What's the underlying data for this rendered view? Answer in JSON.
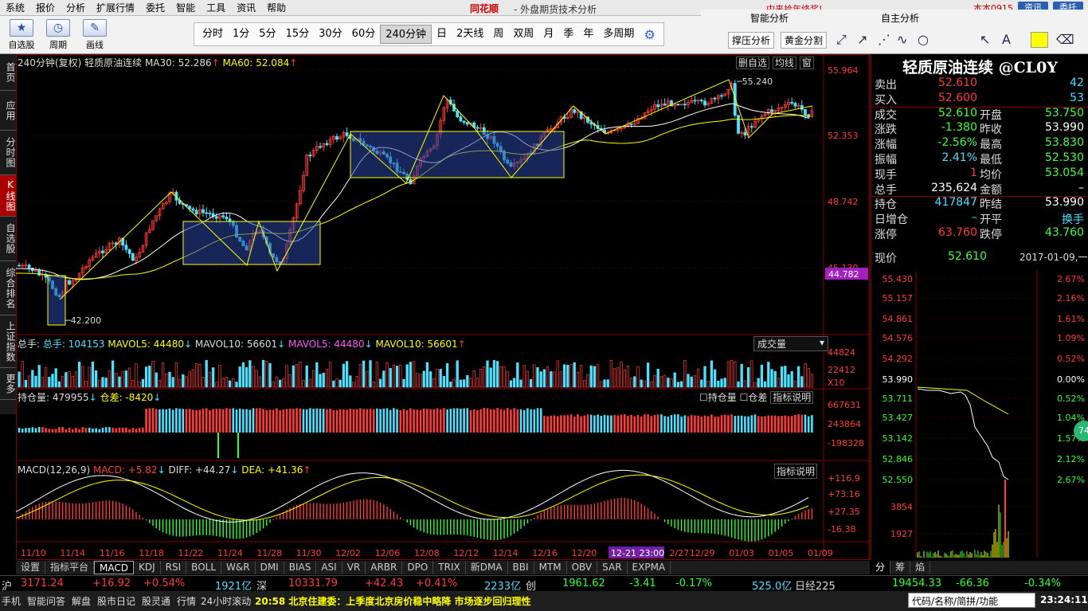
{
  "menu": {
    "items": [
      "系统",
      "报价",
      "分析",
      "扩展行情",
      "委托",
      "智能",
      "工具",
      "资讯",
      "帮助"
    ],
    "brand": "同花顺",
    "title": "- 外盘期货技术分析",
    "marquee": "中来拾年终奖!",
    "user": "本本0915",
    "btn_info": "资讯",
    "btn_trade": "委托"
  },
  "toolbar": {
    "zixuan": "自选股",
    "zhouqi": "周期",
    "huaxian": "画线",
    "periods": [
      "分时",
      "1分",
      "5分",
      "15分",
      "30分",
      "60分",
      "240分钟",
      "日",
      "2天线",
      "周",
      "双周",
      "月",
      "季",
      "年",
      "多周期"
    ],
    "selected_period": "240分钟"
  },
  "rtools": {
    "smart": "智能分析",
    "self": "自主分析",
    "btn_support": "撑压分析",
    "btn_golden": "黄金分割"
  },
  "lefttabs": [
    "首页",
    "应用",
    "分时图",
    "K线图",
    "自选股",
    "综合排名",
    "上证指数",
    "更多"
  ],
  "chart": {
    "header": {
      "period": "240分钟(复权)",
      "name": "轻质原油连续",
      "ma30": "MA30: 52.286",
      "ma60": "MA60: 52.084",
      "btn_add": "删自选",
      "btn_ma": "均线",
      "btn_win": "窗"
    },
    "price_axis": [
      "55.964",
      "52.353",
      "48.742",
      "45.130"
    ],
    "current_tag": "44.782",
    "high_label": "55.240",
    "low_label": "42.200",
    "vol_header": {
      "total": "总手: 104153",
      "mavol5": "MAVOL5: 44480",
      "mavol10": "MAVOL10: 56601",
      "mavol5b": "MAVOL5: 44480",
      "mavol10b": "MAVOL10: 56601",
      "dropdown": "成交量"
    },
    "vol_axis": [
      "44824",
      "22412",
      "X10"
    ],
    "oi_header": {
      "oi": "持仓量: 479955",
      "diff": "仓差: -8420",
      "chk_oi": "持仓量",
      "chk_diff": "仓差",
      "btn": "指标说明"
    },
    "oi_axis": [
      "667631",
      "243864",
      "-198328"
    ],
    "macd_header": {
      "name": "MACD(12,26,9)",
      "macd": "MACD: +5.82",
      "diff": "DIFF: +44.27",
      "dea": "DEA: +41.36",
      "btn": "指标说明"
    },
    "macd_axis": [
      "+116.9",
      "+73.16",
      "+27.35",
      "-16.38"
    ],
    "dates": [
      "11/10",
      "11/14",
      "11/16",
      "11/18",
      "11/22",
      "11/24",
      "11/28",
      "11/30",
      "12/02",
      "12/06",
      "12/08",
      "12/12",
      "12/14",
      "12/16",
      "12/20",
      "12-21 23:00",
      "2/27",
      "12/29",
      "01/03",
      "01/05",
      "01/09"
    ]
  },
  "quote": {
    "name": "轻质原油连续 @CL0Y",
    "rows": [
      {
        "l": "卖出",
        "v": "52.610",
        "l2": "",
        "v2": "42"
      },
      {
        "l": "买入",
        "v": "52.600",
        "l2": "",
        "v2": "53"
      },
      {
        "l": "成交",
        "v": "52.610",
        "l2": "开盘",
        "v2": "53.750"
      },
      {
        "l": "涨跌",
        "v": "-1.380",
        "l2": "昨收",
        "v2": "53.990"
      },
      {
        "l": "涨幅",
        "v": "-2.56%",
        "l2": "最高",
        "v2": "53.830"
      },
      {
        "l": "振幅",
        "v": "2.41%",
        "l2": "最低",
        "v2": "52.530"
      },
      {
        "l": "现手",
        "v": "1",
        "l2": "均价",
        "v2": "53.054"
      },
      {
        "l": "总手",
        "v": "235,624",
        "l2": "金额",
        "v2": "–"
      },
      {
        "l": "持仓",
        "v": "417847",
        "l2": "昨结",
        "v2": "53.990"
      },
      {
        "l": "日增仓",
        "v": "–",
        "l2": "开平",
        "v2": "换手"
      },
      {
        "l": "涨停",
        "v": "63.760",
        "l2": "跌停",
        "v2": "43.760"
      }
    ],
    "now_label": "现价",
    "now_value": "52.610",
    "now_date": "2017-01-09,一",
    "mini_left": [
      "55.430",
      "55.157",
      "54.861",
      "54.576",
      "54.292",
      "53.990",
      "53.711",
      "53.427",
      "53.142",
      "52.846",
      "52.550",
      "3854",
      "1927"
    ],
    "mini_right": [
      "2.67%",
      "2.16%",
      "1.61%",
      "1.09%",
      "0.52%",
      "0.00%",
      "0.52%",
      "1.04%",
      "1.57%",
      "2.12%",
      "2.67%"
    ],
    "bubble": "74"
  },
  "indtabs": [
    "设置",
    "指标平台",
    "MACD",
    "KDJ",
    "RSI",
    "BOLL",
    "W&R",
    "DMI",
    "BIAS",
    "ASI",
    "VR",
    "ARBR",
    "DPO",
    "TRIX",
    "新DMA",
    "BBI",
    "MTM",
    "OBV",
    "SAR",
    "EXPMA"
  ],
  "qtabs": [
    "分",
    "筹",
    "焰"
  ],
  "ticker": {
    "sh": "沪",
    "sh_v": "3171.24",
    "sh_c": "+16.92",
    "sh_p": "+0.54%",
    "sh_amt": "1921亿",
    "sz": "深",
    "sz_v": "10331.79",
    "sz_c": "+42.43",
    "sz_p": "+0.41%",
    "sz_amt": "2233亿",
    "cy": "创",
    "cy_v": "1961.62",
    "cy_c": "-3.41",
    "cy_p": "-0.17%",
    "cy_amt": "525.0亿",
    "nk": "日经225",
    "nk_v": "19454.33",
    "nk_c": "-66.36",
    "nk_p": "-0.34%"
  },
  "statusbar": {
    "items": [
      "手机",
      "智能问答",
      "解盘",
      "股市日记",
      "股灵通",
      "行情",
      "24小时滚动"
    ],
    "news": "20:58 北京住建委：上季度北京房价稳中略降 市场逐步回归理性",
    "search": "代码/名称/简拼/功能",
    "time": "23:24:11"
  }
}
